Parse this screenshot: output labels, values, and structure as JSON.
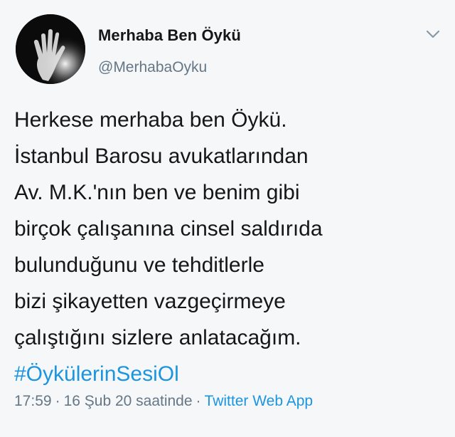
{
  "tweet": {
    "author": {
      "display_name": "Merhaba Ben Öykü",
      "handle": "@MerhabaOyku",
      "avatar_icon": "hand-silhouette-avatar"
    },
    "menu_icon": "chevron-down-icon",
    "text_lines": [
      "Herkese merhaba ben Öykü.",
      "İstanbul Barosu avukatlarından",
      "Av. M.K.'nın ben ve benim gibi",
      "birçok çalışanına cinsel saldırıda",
      "bulunduğunu ve tehditlerle",
      "bizi şikayetten vazgeçirmeye",
      "çalıştığını sizlere anlatacağım."
    ],
    "hashtag": "#ÖykülerinSesiOl",
    "meta": {
      "time": "17:59",
      "date": "16 Şub 20 saatinde",
      "separator": "·",
      "source": "Twitter Web App"
    }
  },
  "colors": {
    "background": "#f6f7f8",
    "text": "#14171a",
    "secondary": "#657786",
    "link": "#1b95e0"
  }
}
